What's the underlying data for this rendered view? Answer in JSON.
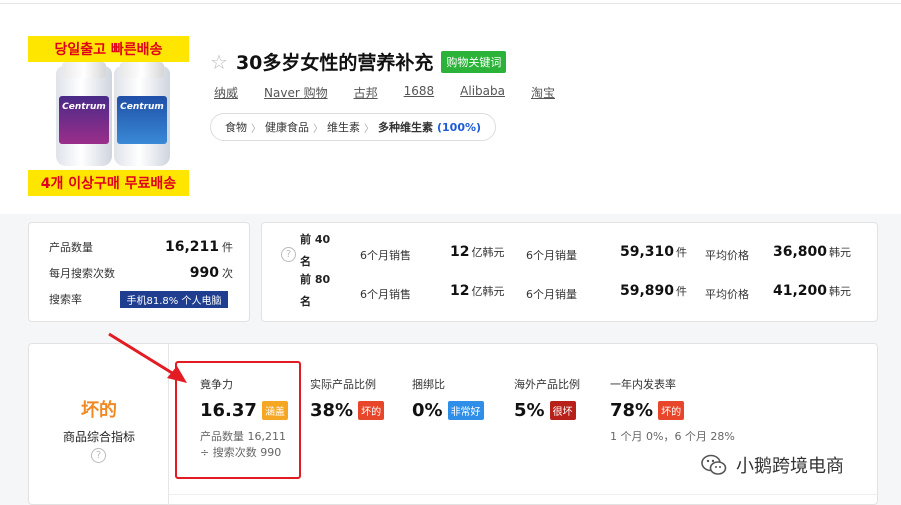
{
  "product": {
    "banner_top": "당일출고 빠른배송",
    "banner_bottom": "4개 이상구매 무료배송",
    "bottle_brand": "Centrum",
    "title": "30多岁女性的营养补充",
    "keyword_badge": "购物关键词",
    "links": [
      "纳威",
      "Naver 购物",
      "古邦",
      "1688",
      "Alibaba",
      "淘宝"
    ],
    "breadcrumb": [
      "食物",
      "健康食品",
      "维生素",
      "多种维生素"
    ],
    "breadcrumb_pct": "(100%)"
  },
  "summary": {
    "product_count_label": "产品数量",
    "product_count": "16,211",
    "product_count_unit": "件",
    "monthly_search_label": "每月搜索次数",
    "monthly_search": "990",
    "monthly_search_unit": "次",
    "search_rate_label": "搜索率",
    "search_rate_tag": "手机81.8% 个人电脑"
  },
  "ranking": {
    "rows": [
      {
        "rank_a": "前 40",
        "rank_b": "名",
        "sales_label": "6个月销售",
        "sales": "12",
        "sales_unit": "亿韩元",
        "qty_label": "6个月销量",
        "qty": "59,310",
        "qty_unit": "件",
        "avg_label": "平均价格",
        "avg": "36,800",
        "avg_unit": "韩元"
      },
      {
        "rank_a": "前 80",
        "rank_b": "名",
        "sales_label": "6个月销售",
        "sales": "12",
        "sales_unit": "亿韩元",
        "qty_label": "6个月销量",
        "qty": "59,890",
        "qty_unit": "件",
        "avg_label": "平均价格",
        "avg": "41,200",
        "avg_unit": "韩元"
      }
    ]
  },
  "indicators": {
    "overall": "坏的",
    "overall_label": "商品综合指标",
    "competitiveness": {
      "label": "竟争力",
      "value": "16.37",
      "tag": "涵盖",
      "sub1": "产品数量 16,211",
      "sub2": "÷ 搜索次数 990"
    },
    "actual_ratio": {
      "label": "实际产品比例",
      "value": "38%",
      "tag": "坏的"
    },
    "bundle_ratio": {
      "label": "捆绑比",
      "value": "0%",
      "tag": "非常好"
    },
    "overseas_ratio": {
      "label": "海外产品比例",
      "value": "5%",
      "tag": "很坏"
    },
    "yearly_launch": {
      "label": "一年内发表率",
      "value": "78%",
      "tag": "坏的",
      "sub": "1 个月 0%，6 个月 28%"
    }
  },
  "watermark": "小鹅跨境电商",
  "colors": {
    "highlight": "#e31b23",
    "bad": "#f08a24",
    "keyword_badge": "#2ab338"
  }
}
